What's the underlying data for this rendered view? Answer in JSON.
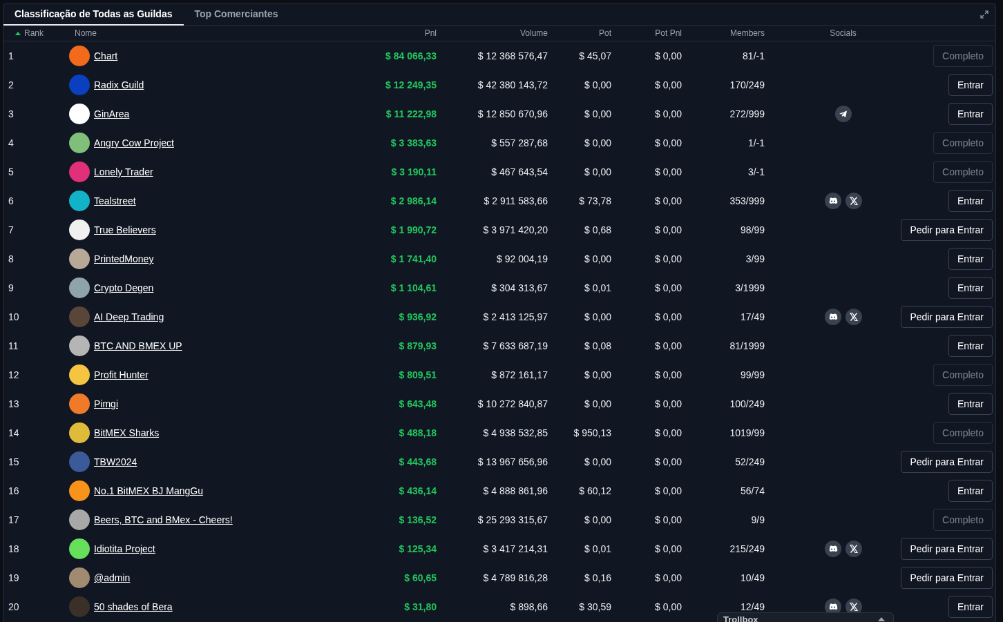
{
  "tabs": [
    {
      "label": "Classificação de Todas as Guildas",
      "selected": true
    },
    {
      "label": "Top Comerciantes",
      "selected": false
    }
  ],
  "columns": [
    {
      "label": "Rank",
      "sorted": true
    },
    {
      "label": "Nome",
      "sorted": false
    },
    {
      "label": "Pnl",
      "sorted": false
    },
    {
      "label": "Volume",
      "sorted": false
    },
    {
      "label": "Pot",
      "sorted": false
    },
    {
      "label": "Pot Pnl",
      "sorted": false
    },
    {
      "label": "Members",
      "sorted": false
    },
    {
      "label": "Socials",
      "sorted": false
    }
  ],
  "rows": [
    {
      "rank": "1",
      "name": "Chart",
      "color": "#f26a1b",
      "pnl": "$ 84 066,33",
      "volume": "$ 12 368 576,47",
      "pot": "$ 45,07",
      "pot_pnl": "$ 0,00",
      "members": "81/-1",
      "socials": [],
      "action": {
        "label": "Completo",
        "disabled": true
      }
    },
    {
      "rank": "2",
      "name": "Radix Guild",
      "color": "#0a3fbf",
      "pnl": "$ 12 249,35",
      "volume": "$ 42 380 143,72",
      "pot": "$ 0,00",
      "pot_pnl": "$ 0,00",
      "members": "170/249",
      "socials": [],
      "action": {
        "label": "Entrar",
        "disabled": false
      }
    },
    {
      "rank": "3",
      "name": "GinArea",
      "color": "#ffffff",
      "pnl": "$ 11 222,98",
      "volume": "$ 12 850 670,96",
      "pot": "$ 0,00",
      "pot_pnl": "$ 0,00",
      "members": "272/999",
      "socials": [
        {
          "kind": "telegram"
        }
      ],
      "action": {
        "label": "Entrar",
        "disabled": false
      }
    },
    {
      "rank": "4",
      "name": "Angry Cow Project",
      "color": "#7fbf7a",
      "pnl": "$ 3 383,63",
      "volume": "$ 557 287,68",
      "pot": "$ 0,00",
      "pot_pnl": "$ 0,00",
      "members": "1/-1",
      "socials": [],
      "action": {
        "label": "Completo",
        "disabled": true
      }
    },
    {
      "rank": "5",
      "name": "Lonely Trader",
      "color": "#e0307a",
      "pnl": "$ 3 190,11",
      "volume": "$ 467 643,54",
      "pot": "$ 0,00",
      "pot_pnl": "$ 0,00",
      "members": "3/-1",
      "socials": [],
      "action": {
        "label": "Completo",
        "disabled": true
      }
    },
    {
      "rank": "6",
      "name": "Tealstreet",
      "color": "#12b3c8",
      "pnl": "$ 2 986,14",
      "volume": "$ 2 911 583,66",
      "pot": "$ 73,78",
      "pot_pnl": "$ 0,00",
      "members": "353/999",
      "socials": [
        {
          "kind": "discord"
        },
        {
          "kind": "x"
        }
      ],
      "action": {
        "label": "Entrar",
        "disabled": false
      }
    },
    {
      "rank": "7",
      "name": "True Believers",
      "color": "#f0f0f0",
      "pnl": "$ 1 990,72",
      "volume": "$ 3 971 420,20",
      "pot": "$ 0,68",
      "pot_pnl": "$ 0,00",
      "members": "98/99",
      "socials": [],
      "action": {
        "label": "Pedir para Entrar",
        "disabled": false
      }
    },
    {
      "rank": "8",
      "name": "PrintedMoney",
      "color": "#b8a898",
      "pnl": "$ 1 741,40",
      "volume": "$ 92 004,19",
      "pot": "$ 0,00",
      "pot_pnl": "$ 0,00",
      "members": "3/99",
      "socials": [],
      "action": {
        "label": "Entrar",
        "disabled": false
      }
    },
    {
      "rank": "9",
      "name": "Crypto Degen",
      "color": "#8fa3ad",
      "pnl": "$ 1 104,61",
      "volume": "$ 304 313,67",
      "pot": "$ 0,01",
      "pot_pnl": "$ 0,00",
      "members": "3/1999",
      "socials": [],
      "action": {
        "label": "Entrar",
        "disabled": false
      }
    },
    {
      "rank": "10",
      "name": "AI Deep Trading",
      "color": "#5a4638",
      "pnl": "$ 936,92",
      "volume": "$ 2 413 125,97",
      "pot": "$ 0,00",
      "pot_pnl": "$ 0,00",
      "members": "17/49",
      "socials": [
        {
          "kind": "discord"
        },
        {
          "kind": "x"
        }
      ],
      "action": {
        "label": "Pedir para Entrar",
        "disabled": false
      }
    },
    {
      "rank": "11",
      "name": "BTC AND BMEX UP",
      "color": "#b5b5b5",
      "pnl": "$ 879,93",
      "volume": "$ 7 633 687,19",
      "pot": "$ 0,08",
      "pot_pnl": "$ 0,00",
      "members": "81/1999",
      "socials": [],
      "action": {
        "label": "Entrar",
        "disabled": false
      }
    },
    {
      "rank": "12",
      "name": "Profit Hunter",
      "color": "#f5c542",
      "pnl": "$ 809,51",
      "volume": "$ 872 161,17",
      "pot": "$ 0,00",
      "pot_pnl": "$ 0,00",
      "members": "99/99",
      "socials": [],
      "action": {
        "label": "Completo",
        "disabled": true
      }
    },
    {
      "rank": "13",
      "name": "Pimgi",
      "color": "#f07a2a",
      "pnl": "$ 643,48",
      "volume": "$ 10 272 840,87",
      "pot": "$ 0,00",
      "pot_pnl": "$ 0,00",
      "members": "100/249",
      "socials": [],
      "action": {
        "label": "Entrar",
        "disabled": false
      }
    },
    {
      "rank": "14",
      "name": "BitMEX Sharks",
      "color": "#e0bb3a",
      "pnl": "$ 488,18",
      "volume": "$ 4 938 532,85",
      "pot": "$ 950,13",
      "pot_pnl": "$ 0,00",
      "members": "1019/99",
      "socials": [],
      "action": {
        "label": "Completo",
        "disabled": true
      }
    },
    {
      "rank": "15",
      "name": "TBW2024",
      "color": "#3b5a9a",
      "pnl": "$ 443,68",
      "volume": "$ 13 967 656,96",
      "pot": "$ 0,00",
      "pot_pnl": "$ 0,00",
      "members": "52/249",
      "socials": [],
      "action": {
        "label": "Pedir para Entrar",
        "disabled": false
      }
    },
    {
      "rank": "16",
      "name": "No.1 BitMEX BJ MangGu",
      "color": "#f7931a",
      "pnl": "$ 436,14",
      "volume": "$ 4 888 861,96",
      "pot": "$ 60,12",
      "pot_pnl": "$ 0,00",
      "members": "56/74",
      "socials": [],
      "action": {
        "label": "Entrar",
        "disabled": false
      }
    },
    {
      "rank": "17",
      "name": "Beers, BTC and BMex - Cheers!",
      "color": "#a8a8a8",
      "pnl": "$ 136,52",
      "volume": "$ 25 293 315,67",
      "pot": "$ 0,00",
      "pot_pnl": "$ 0,00",
      "members": "9/9",
      "socials": [],
      "action": {
        "label": "Completo",
        "disabled": true
      }
    },
    {
      "rank": "18",
      "name": "Idiotita Project",
      "color": "#66e05a",
      "pnl": "$ 125,34",
      "volume": "$ 3 417 214,31",
      "pot": "$ 0,01",
      "pot_pnl": "$ 0,00",
      "members": "215/249",
      "socials": [
        {
          "kind": "discord"
        },
        {
          "kind": "x"
        }
      ],
      "action": {
        "label": "Pedir para Entrar",
        "disabled": false
      }
    },
    {
      "rank": "19",
      "name": "@admin",
      "color": "#a08a70",
      "pnl": "$ 60,65",
      "volume": "$ 4 789 816,28",
      "pot": "$ 0,16",
      "pot_pnl": "$ 0,00",
      "members": "10/49",
      "socials": [],
      "action": {
        "label": "Pedir para Entrar",
        "disabled": false
      }
    },
    {
      "rank": "20",
      "name": "50 shades of Bera",
      "color": "#3a3028",
      "pnl": "$ 31,80",
      "volume": "$ 898,66",
      "pot": "$ 30,59",
      "pot_pnl": "$ 0,00",
      "members": "12/49",
      "socials": [
        {
          "kind": "discord"
        },
        {
          "kind": "x"
        }
      ],
      "action": {
        "label": "Entrar",
        "disabled": false
      }
    }
  ],
  "trollbox": {
    "title": "Trollbox"
  }
}
